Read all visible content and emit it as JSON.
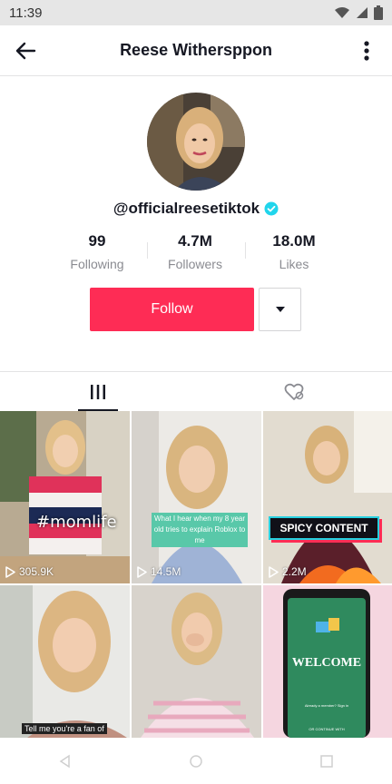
{
  "status_bar": {
    "time": "11:39",
    "icons": [
      "wifi-icon",
      "signal-icon",
      "battery-icon"
    ]
  },
  "header": {
    "title": "Reese Withersppon",
    "back_icon": "back-arrow-icon",
    "more_icon": "more-vertical-icon"
  },
  "profile": {
    "handle": "@officialreesetiktok",
    "verified": true,
    "stats": [
      {
        "value": "99",
        "label": "Following"
      },
      {
        "value": "4.7M",
        "label": "Followers"
      },
      {
        "value": "18.0M",
        "label": "Likes"
      }
    ]
  },
  "actions": {
    "follow_label": "Follow",
    "dropdown_icon": "caret-down-icon"
  },
  "tabs": [
    {
      "icon": "grid-icon",
      "active": true
    },
    {
      "icon": "liked-heart-icon",
      "active": false
    }
  ],
  "videos": [
    {
      "views": "305.9K",
      "overlay_text": "#momlife"
    },
    {
      "views": "14.5M",
      "overlay_text": "What I hear when my 8 year old tries to explain Roblox to me"
    },
    {
      "views": "2.2M",
      "overlay_text": "SPICY CONTENT"
    },
    {
      "views": "",
      "overlay_text": "Tell me you're a fan of"
    },
    {
      "views": "",
      "overlay_text": ""
    },
    {
      "views": "",
      "overlay_text": "WELCOME",
      "small_text_1": "Already a member? Sign in",
      "small_text_2": "OR CONTINUE WITH"
    }
  ],
  "colors": {
    "accent": "#fe2c55",
    "verified": "#20d5ec",
    "text": "#161823",
    "muted": "#8a8b91"
  }
}
